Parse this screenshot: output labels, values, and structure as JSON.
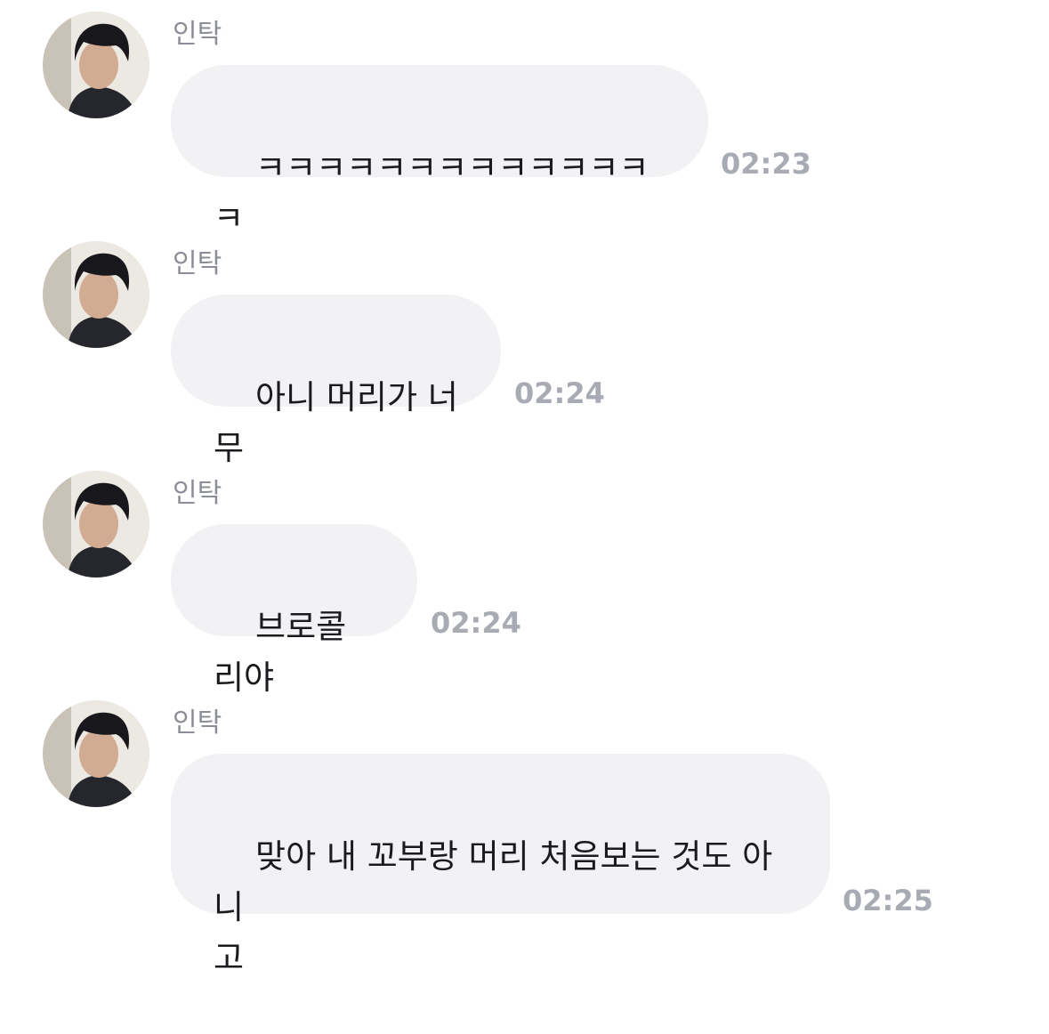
{
  "messages": [
    {
      "sender": "인탁",
      "text": "ㅋㅋㅋㅋㅋㅋㅋㅋㅋㅋㅋㅋㅋㅋ",
      "time": "02:23"
    },
    {
      "sender": "인탁",
      "text": "아니 머리가 너무",
      "time": "02:24"
    },
    {
      "sender": "인탁",
      "text": "브로콜리야",
      "time": "02:24"
    },
    {
      "sender": "인탁",
      "text": "맞아 내 꼬부랑 머리 처음보는 것도 아니\n고",
      "time": "02:25"
    }
  ]
}
